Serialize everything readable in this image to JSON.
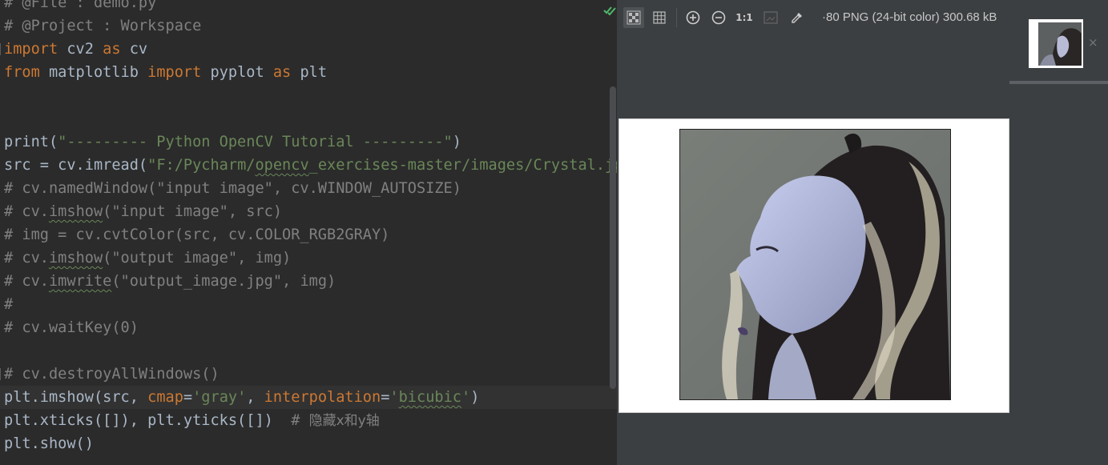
{
  "editor": {
    "lines": [
      [
        {
          "t": "# @File : demo.py",
          "c": "cmt"
        }
      ],
      [
        {
          "t": "# @Project : Workspace",
          "c": "cmt"
        }
      ],
      [
        {
          "t": "import",
          "c": "kw"
        },
        {
          "t": " cv2 ",
          "c": "plain"
        },
        {
          "t": "as",
          "c": "kw"
        },
        {
          "t": " cv",
          "c": "plain"
        }
      ],
      [
        {
          "t": "from",
          "c": "kw"
        },
        {
          "t": " matplotlib ",
          "c": "plain"
        },
        {
          "t": "import",
          "c": "kw"
        },
        {
          "t": " pyplot ",
          "c": "plain"
        },
        {
          "t": "as",
          "c": "kw"
        },
        {
          "t": " plt",
          "c": "plain"
        }
      ],
      [],
      [],
      [
        {
          "t": "print(",
          "c": "plain"
        },
        {
          "t": "\"--------- Python OpenCV Tutorial ---------\"",
          "c": "str"
        },
        {
          "t": ")",
          "c": "plain"
        }
      ],
      [
        {
          "t": "src = cv.imread(",
          "c": "plain"
        },
        {
          "t": "\"F:/Pycharm/",
          "c": "str"
        },
        {
          "t": "opencv",
          "c": "str",
          "u": true
        },
        {
          "t": "_exercises-master/images/Crystal.jpg",
          "c": "str"
        }
      ],
      [
        {
          "t": "# cv.namedWindow(\"input image\", cv.WINDOW_AUTOSIZE)",
          "c": "cmt"
        }
      ],
      [
        {
          "t": "# cv.",
          "c": "cmt"
        },
        {
          "t": "imshow",
          "c": "cmt",
          "u": true
        },
        {
          "t": "(\"input image\", src)",
          "c": "cmt"
        }
      ],
      [
        {
          "t": "# img = cv.cvtColor(src, cv.COLOR_RGB2GRAY)",
          "c": "cmt"
        }
      ],
      [
        {
          "t": "# cv.",
          "c": "cmt"
        },
        {
          "t": "imshow",
          "c": "cmt",
          "u": true
        },
        {
          "t": "(\"output image\", img)",
          "c": "cmt"
        }
      ],
      [
        {
          "t": "# cv.",
          "c": "cmt"
        },
        {
          "t": "imwrite",
          "c": "cmt",
          "u": true
        },
        {
          "t": "(\"output_image.jpg\", img)",
          "c": "cmt"
        }
      ],
      [
        {
          "t": "#",
          "c": "cmt"
        }
      ],
      [
        {
          "t": "# cv.waitKey(0)",
          "c": "cmt"
        }
      ],
      [],
      [
        {
          "t": "# cv.destroyAllWindows()",
          "c": "cmt"
        }
      ],
      [
        {
          "t": "plt.imshow(src, ",
          "c": "plain"
        },
        {
          "t": "cmap",
          "c": "kw"
        },
        {
          "t": "=",
          "c": "plain"
        },
        {
          "t": "'gray'",
          "c": "str"
        },
        {
          "t": ", ",
          "c": "plain"
        },
        {
          "t": "interpolation",
          "c": "kw"
        },
        {
          "t": "=",
          "c": "plain"
        },
        {
          "t": "'",
          "c": "str"
        },
        {
          "t": "bicubic",
          "c": "str",
          "u": true
        },
        {
          "t": "'",
          "c": "str"
        },
        {
          "t": ")",
          "c": "plain"
        }
      ],
      [
        {
          "t": "plt.xticks([]), plt.yticks([])  ",
          "c": "plain"
        },
        {
          "t": "# ",
          "c": "cmt"
        },
        {
          "t": "隐藏x和y轴",
          "c": "cn"
        }
      ],
      [
        {
          "t": "plt.show()",
          "c": "plain"
        }
      ]
    ],
    "current_line": 17,
    "fold_lines": [
      2,
      16
    ]
  },
  "viewer": {
    "image_info": "·80 PNG (24-bit color) 300.68 kB",
    "toolbar": {
      "chessboard": "chessboard-icon",
      "grid": "grid-icon",
      "zoom_in": "zoom-in-icon",
      "zoom_out": "zoom-out-icon",
      "actual_size": "1:1",
      "fit": "fit-zoom-icon",
      "color_picker": "eyedropper-icon"
    },
    "thumbnail_close": "×"
  },
  "colors": {
    "editor_bg": "#2b2b2b",
    "keyword": "#cc7832",
    "string": "#6a8759",
    "comment": "#808080",
    "text": "#a9b7c6",
    "check": "#4fb96c"
  }
}
